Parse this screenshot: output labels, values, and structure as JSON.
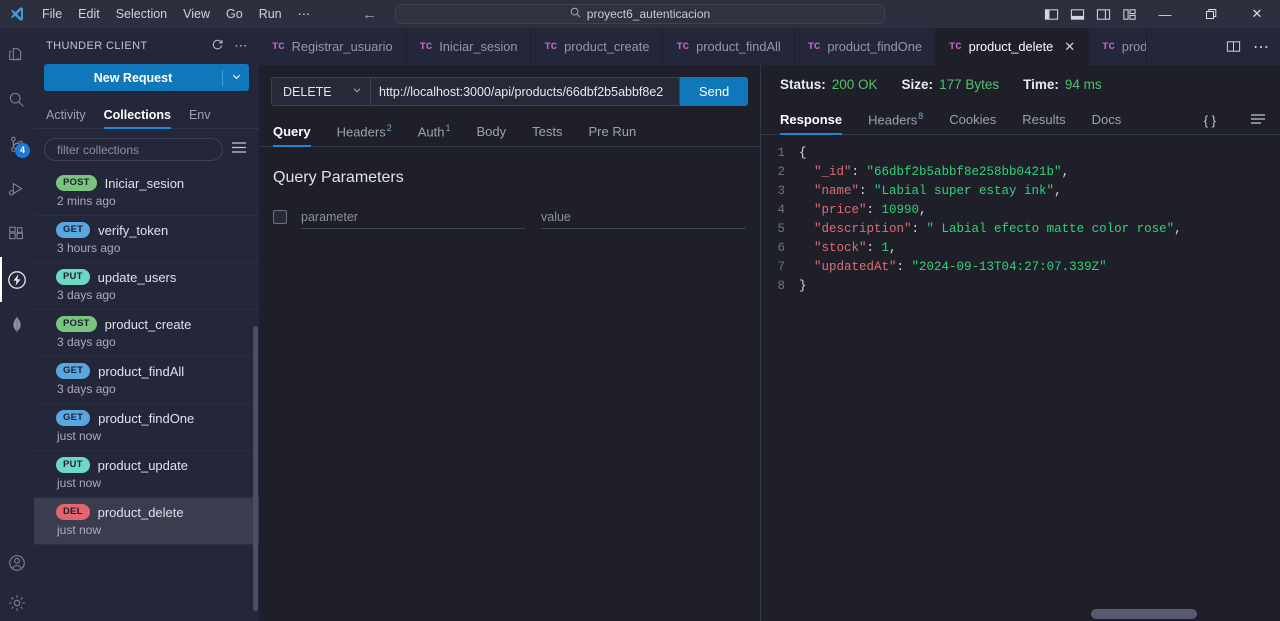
{
  "titlebar": {
    "menu": [
      "File",
      "Edit",
      "Selection",
      "View",
      "Go",
      "Run",
      "⋯"
    ],
    "back_icon": "arrow-left-icon",
    "forward_icon": "arrow-right-icon",
    "search_text": "proyect6_autenticacion",
    "search_icon": "search-icon",
    "layout_icons": [
      "toggle-primary-sidebar-icon",
      "toggle-panel-icon",
      "toggle-secondary-sidebar-icon",
      "customize-layout-icon"
    ],
    "minimize": "—",
    "restore": "❐",
    "close": "✕"
  },
  "activitybar": {
    "items": [
      {
        "name": "explorer-icon",
        "badge": ""
      },
      {
        "name": "search-icon",
        "badge": ""
      },
      {
        "name": "source-control-icon",
        "badge": "4"
      },
      {
        "name": "run-debug-icon",
        "badge": ""
      },
      {
        "name": "extensions-icon",
        "badge": ""
      },
      {
        "name": "thunder-client-icon",
        "badge": ""
      },
      {
        "name": "mongodb-leaf-icon",
        "badge": ""
      }
    ],
    "bottom": [
      {
        "name": "account-icon"
      },
      {
        "name": "settings-gear-icon"
      }
    ]
  },
  "sidebar": {
    "title": "THUNDER CLIENT",
    "refresh_icon": "refresh-icon",
    "more_icon": "more-actions-icon",
    "new_request_label": "New Request",
    "new_request_caret": "⌄",
    "tabs": [
      {
        "label": "Activity",
        "active": false
      },
      {
        "label": "Collections",
        "active": true
      },
      {
        "label": "Env",
        "active": false
      }
    ],
    "filter_placeholder": "filter collections",
    "menu_icon": "hamburger-menu-icon",
    "requests": [
      {
        "method": "POST",
        "name": "Iniciar_sesion",
        "time": "2 mins ago",
        "selected": false
      },
      {
        "method": "GET",
        "name": "verify_token",
        "time": "3 hours ago",
        "selected": false
      },
      {
        "method": "PUT",
        "name": "update_users",
        "time": "3 days ago",
        "selected": false
      },
      {
        "method": "POST",
        "name": "product_create",
        "time": "3 days ago",
        "selected": false
      },
      {
        "method": "GET",
        "name": "product_findAll",
        "time": "3 days ago",
        "selected": false
      },
      {
        "method": "GET",
        "name": "product_findOne",
        "time": "just now",
        "selected": false
      },
      {
        "method": "PUT",
        "name": "product_update",
        "time": "just now",
        "selected": false
      },
      {
        "method": "DEL",
        "name": "product_delete",
        "time": "just now",
        "selected": true
      }
    ]
  },
  "editor": {
    "tabs": [
      {
        "label": "Registrar_usuario",
        "icon": "TC",
        "active": false,
        "closable": false
      },
      {
        "label": "Iniciar_sesion",
        "icon": "TC",
        "active": false,
        "closable": false
      },
      {
        "label": "product_create",
        "icon": "TC",
        "active": false,
        "closable": false
      },
      {
        "label": "product_findAll",
        "icon": "TC",
        "active": false,
        "closable": false
      },
      {
        "label": "product_findOne",
        "icon": "TC",
        "active": false,
        "closable": false
      },
      {
        "label": "product_delete",
        "icon": "TC",
        "active": true,
        "closable": true
      },
      {
        "label": "prod",
        "icon": "TC",
        "active": false,
        "closable": false
      }
    ],
    "close_glyph": "✕",
    "actions": [
      {
        "name": "split-editor-icon"
      },
      {
        "name": "more-actions-icon",
        "glyph": "⋯"
      }
    ]
  },
  "request": {
    "method": "DELETE",
    "method_caret": "⌄",
    "url": "http://localhost:3000/api/products/66dbf2b5abbf8e2",
    "send_label": "Send",
    "tabs": [
      {
        "label": "Query",
        "sup": "",
        "active": true
      },
      {
        "label": "Headers",
        "sup": "2",
        "active": false
      },
      {
        "label": "Auth",
        "sup": "1",
        "active": false
      },
      {
        "label": "Body",
        "sup": "",
        "active": false
      },
      {
        "label": "Tests",
        "sup": "",
        "active": false
      },
      {
        "label": "Pre Run",
        "sup": "",
        "active": false
      }
    ],
    "query_title": "Query Parameters",
    "param_placeholder": "parameter",
    "value_placeholder": "value"
  },
  "response": {
    "status_label": "Status:",
    "status_value": "200 OK",
    "size_label": "Size:",
    "size_value": "177 Bytes",
    "time_label": "Time:",
    "time_value": "94 ms",
    "tabs": [
      {
        "label": "Response",
        "sup": "",
        "active": true
      },
      {
        "label": "Headers",
        "sup": "8",
        "active": false
      },
      {
        "label": "Cookies",
        "sup": "",
        "active": false
      },
      {
        "label": "Results",
        "sup": "",
        "active": false
      },
      {
        "label": "Docs",
        "sup": "",
        "active": false
      }
    ],
    "format_icon": "{ }",
    "wrap_icon": "wrap-lines-icon",
    "json_lines": [
      {
        "n": "1",
        "tokens": [
          {
            "t": "{",
            "c": "jpunc"
          }
        ]
      },
      {
        "n": "2",
        "tokens": [
          {
            "t": "  \"_id\"",
            "c": "jkey"
          },
          {
            "t": ": ",
            "c": "jpunc"
          },
          {
            "t": "\"66dbf2b5abbf8e258bb0421b\"",
            "c": "jstr"
          },
          {
            "t": ",",
            "c": "jpunc"
          }
        ]
      },
      {
        "n": "3",
        "tokens": [
          {
            "t": "  \"name\"",
            "c": "jkey"
          },
          {
            "t": ": ",
            "c": "jpunc"
          },
          {
            "t": "\"Labial super estay ink\"",
            "c": "jstr"
          },
          {
            "t": ",",
            "c": "jpunc"
          }
        ]
      },
      {
        "n": "4",
        "tokens": [
          {
            "t": "  \"price\"",
            "c": "jkey"
          },
          {
            "t": ": ",
            "c": "jpunc"
          },
          {
            "t": "10990",
            "c": "jnumv"
          },
          {
            "t": ",",
            "c": "jpunc"
          }
        ]
      },
      {
        "n": "5",
        "tokens": [
          {
            "t": "  \"description\"",
            "c": "jkey"
          },
          {
            "t": ": ",
            "c": "jpunc"
          },
          {
            "t": "\" Labial efecto matte color rose\"",
            "c": "jstr"
          },
          {
            "t": ",",
            "c": "jpunc"
          }
        ]
      },
      {
        "n": "6",
        "tokens": [
          {
            "t": "  \"stock\"",
            "c": "jkey"
          },
          {
            "t": ": ",
            "c": "jpunc"
          },
          {
            "t": "1",
            "c": "jnumv"
          },
          {
            "t": ",",
            "c": "jpunc"
          }
        ]
      },
      {
        "n": "7",
        "tokens": [
          {
            "t": "  \"updatedAt\"",
            "c": "jkey"
          },
          {
            "t": ": ",
            "c": "jpunc"
          },
          {
            "t": "\"2024-09-13T04:27:07.339Z\"",
            "c": "jstr"
          }
        ]
      },
      {
        "n": "8",
        "tokens": [
          {
            "t": "}",
            "c": "jpunc"
          }
        ]
      }
    ]
  },
  "colors": {
    "accent": "#1177bb",
    "tab_underline": "#1f8ad2",
    "status_green": "#52c16b",
    "tc_pink": "#c364c5",
    "json_key": "#e06c75",
    "json_string": "#32d17a"
  }
}
